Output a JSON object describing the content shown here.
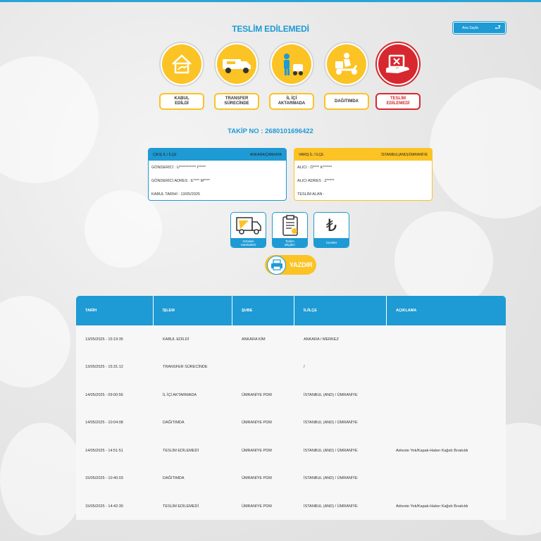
{
  "page": {
    "title": "TESLİM EDİLEMEDİ",
    "home_button": "Ana Sayfa",
    "tracking": "TAKİP NO : 2680101696422"
  },
  "steps": [
    {
      "label": "KABUL\nEDİLDİ",
      "icon": "house-hand-icon",
      "state": "done"
    },
    {
      "label": "TRANSFER\nSÜRECİNDE",
      "icon": "truck-icon",
      "state": "done"
    },
    {
      "label": "İL İÇİ\nAKTARMADA",
      "icon": "worker-cart-icon",
      "state": "done"
    },
    {
      "label": "DAĞITIMDA",
      "icon": "scooter-icon",
      "state": "done"
    },
    {
      "label": "TESLİM\nEDİLEMEDİ",
      "icon": "undelivered-box-icon",
      "state": "current"
    }
  ],
  "sender_card": {
    "header_left": "ÇIKIŞ İL / İLÇE",
    "header_right": "ANKARA/ÇANKAYA",
    "rows": [
      "GÖNDERİCİ : U*********** İ*****",
      "GÖNDERİCİ ADRES : E**** M****",
      "KABUL TARİHİ : 13/05/2025"
    ]
  },
  "receiver_card": {
    "header_left": "VARIŞ İL / İLÇE",
    "header_right": "İSTANBUL(AND)/ÜMRANİYE",
    "rows": [
      "ALICI : Ö**** K******",
      "ALICI ADRES : Z*****",
      "TESLİM ALAN :"
    ]
  },
  "tools": [
    {
      "label": "Gönderi\nHareketleri",
      "icon": "truck-paper-icon"
    },
    {
      "label": "Teslim\nBilgileri",
      "icon": "clipboard-icon"
    },
    {
      "label": "Ücretler",
      "icon": "lira-icon"
    }
  ],
  "print_label": "YAZDIR",
  "table": {
    "headers": [
      "TARİH",
      "İŞLEM",
      "ŞUBE",
      "İL/İLÇE",
      "AÇIKLAMA"
    ],
    "rows": [
      [
        "13/05/2025 - 15:19:35",
        "KABUL EDİLDİ",
        "ANKARA KİM",
        "ANKARA / MERKEZ",
        ""
      ],
      [
        "13/05/2025 - 15:31:12",
        "TRANSFER SÜRECİNDE",
        "",
        "/",
        ""
      ],
      [
        "14/05/2025 - 09:00:56",
        "İL İÇİ AKTARMADA",
        "ÜMRANİYE PDM",
        "İSTANBUL (AND) / ÜMRANİYE",
        ""
      ],
      [
        "14/05/2025 - 10:04:08",
        "DAĞITIMDA",
        "ÜMRANİYE PDM",
        "İSTANBUL (AND) / ÜMRANİYE",
        ""
      ],
      [
        "14/05/2025 - 14:51:51",
        "TESLİM EDİLEMEDİ",
        "ÜMRANİYE PDM",
        "İSTANBUL (AND) / ÜMRANİYE",
        "Adreste Yok/Kapak-Haber Kağıdı Bırakıldı"
      ],
      [
        "15/05/2025 - 10:40:03",
        "DAĞITIMDA",
        "ÜMRANİYE PDM",
        "İSTANBUL (AND) / ÜMRANİYE",
        ""
      ],
      [
        "15/05/2025 - 14:42:30",
        "TESLİM EDİLEMEDİ",
        "ÜMRANİYE PDM",
        "İSTANBUL (AND) / ÜMRANİYE",
        "Adreste Yok/Kapak-Haber Kağıdı Bırakıldı"
      ]
    ]
  },
  "colors": {
    "accent": "#1e9ad4",
    "yellow": "#fbc324",
    "red": "#d7282f"
  }
}
